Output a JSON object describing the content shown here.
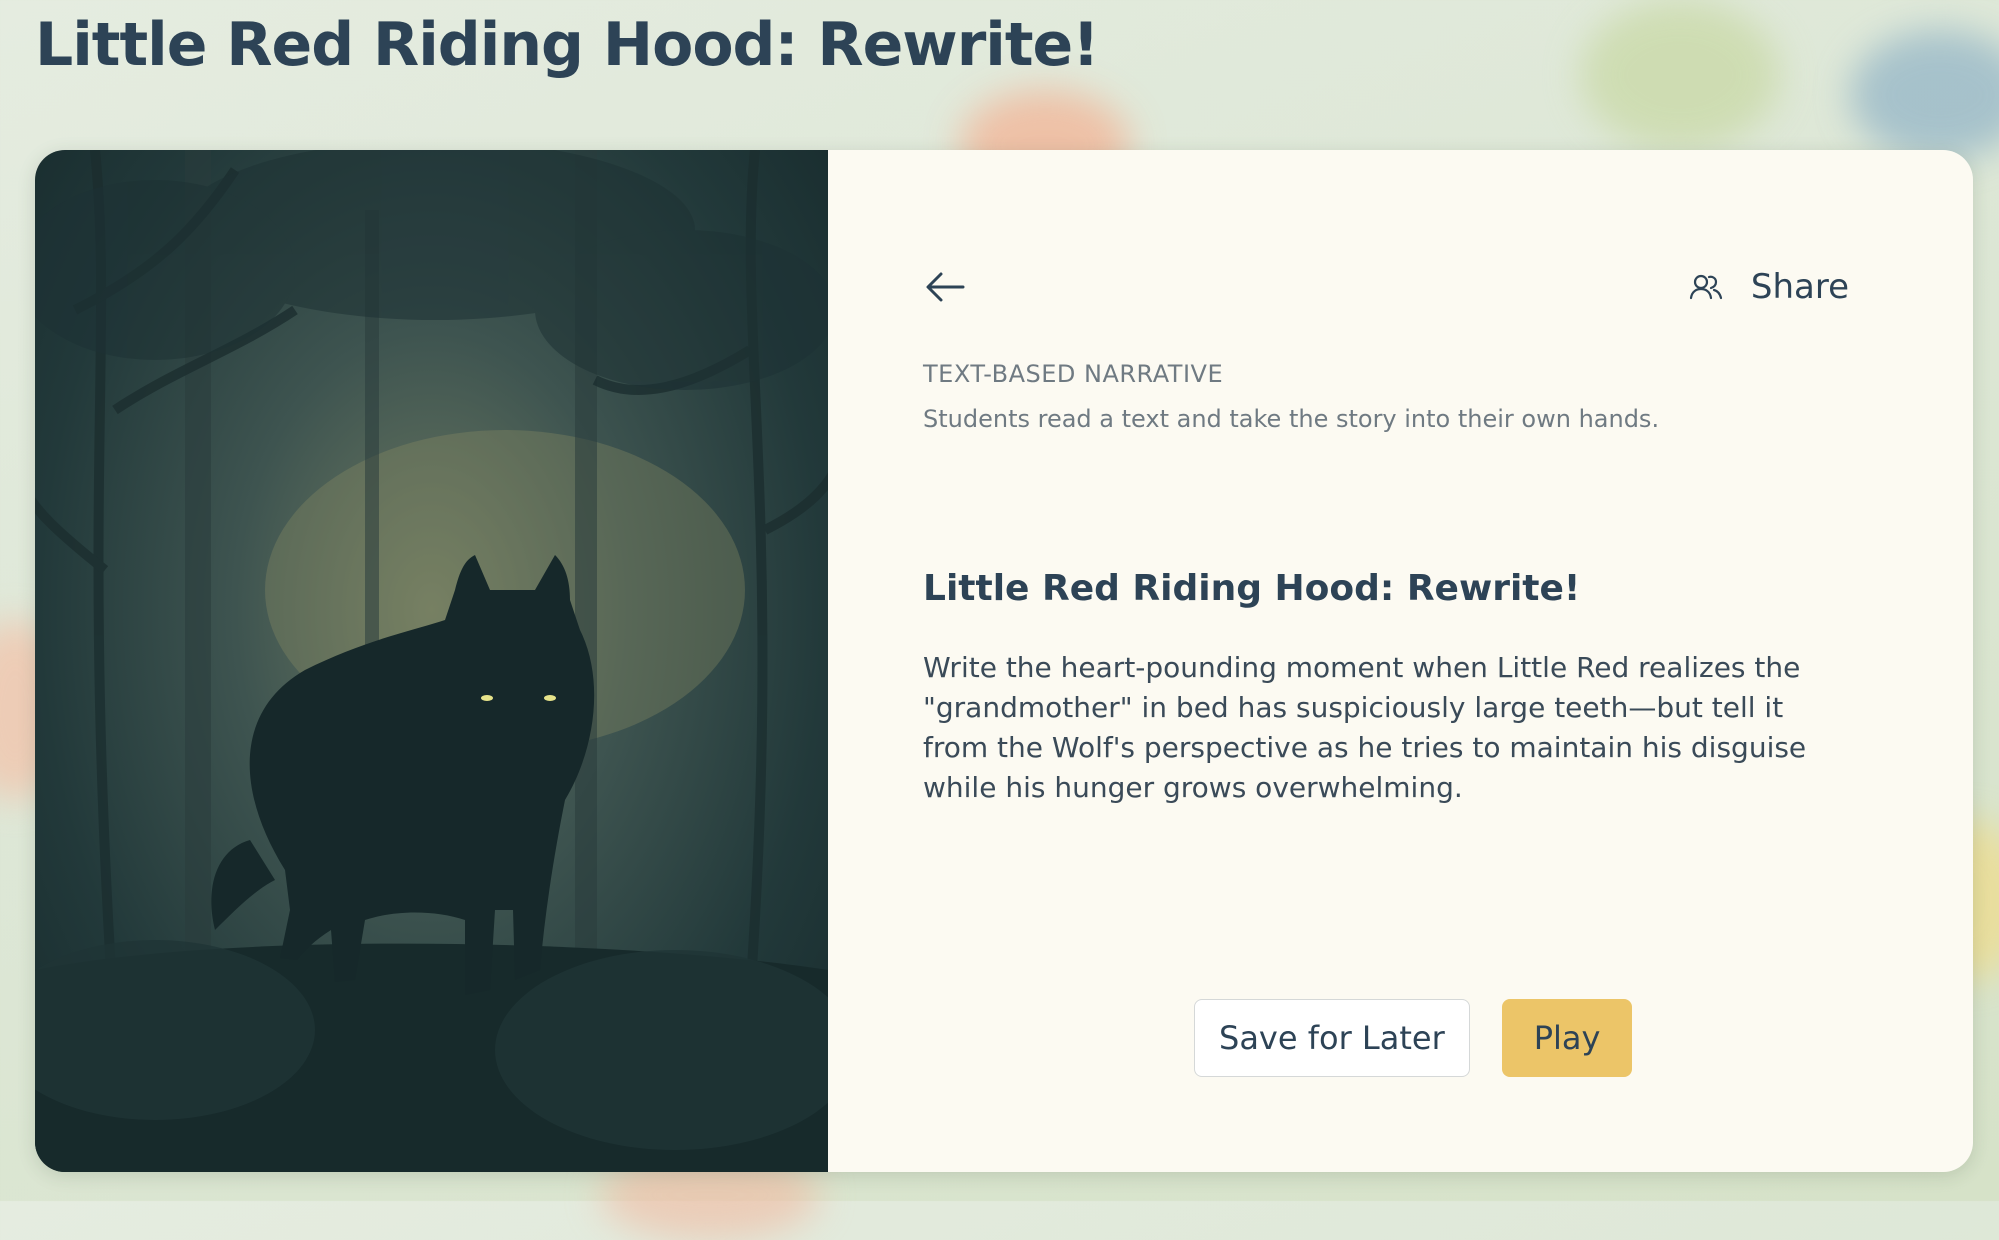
{
  "page": {
    "title": "Little Red Riding Hood: Rewrite!"
  },
  "activity": {
    "type_label": "TEXT-BASED NARRATIVE",
    "type_description": "Students read a text and take the story into their own hands.",
    "title": "Little Red Riding Hood: Rewrite!",
    "description": "Write the heart-pounding moment when Little Red realizes the \"grandmother\" in bed has suspiciously large teeth—but tell it from the Wolf's perspective as he tries to maintain his disguise while his hunger grows overwhelming.",
    "illustration": "wolf-in-misty-forest"
  },
  "toolbar": {
    "back_icon": "arrow-left-icon",
    "share_icon": "people-icon",
    "share_label": "Share"
  },
  "actions": {
    "save_label": "Save for Later",
    "play_label": "Play"
  },
  "colors": {
    "accent": "#ecc568",
    "text_primary": "#2d4356",
    "text_muted": "#6f7a82",
    "panel_bg": "#fcfaf2"
  }
}
